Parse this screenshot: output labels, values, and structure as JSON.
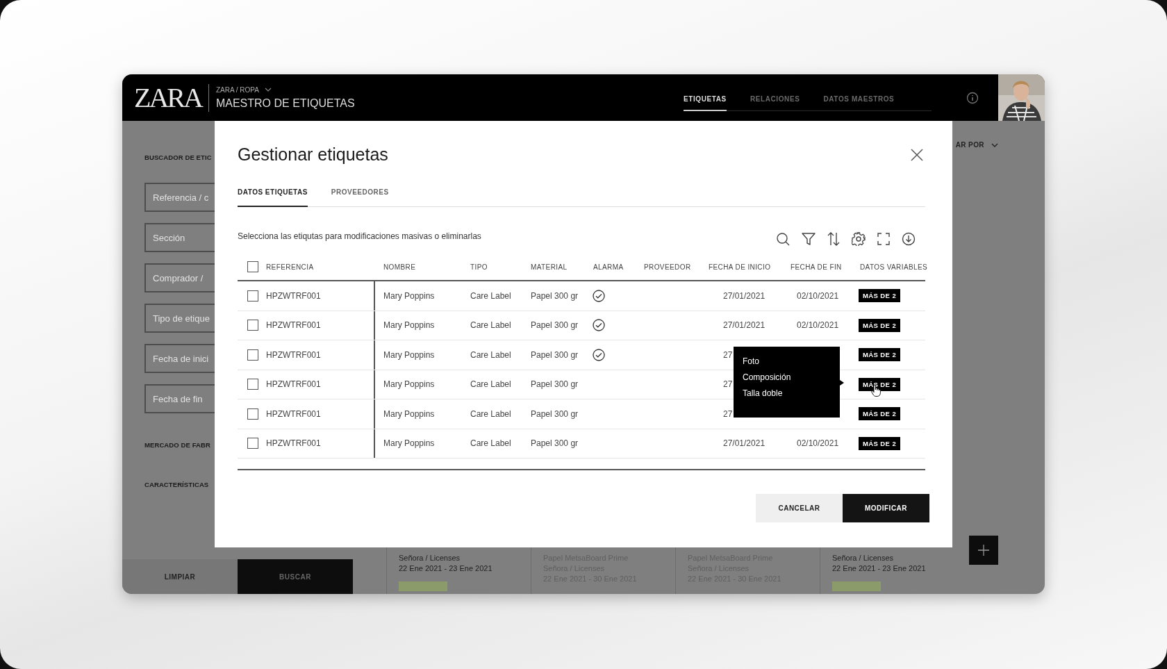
{
  "header": {
    "logo": "ZARA",
    "breadcrumb": "ZARA / ROPA",
    "title": "MAESTRO DE ETIQUETAS",
    "nav": [
      {
        "label": "ETIQUETAS",
        "selected": true
      },
      {
        "label": "RELACIONES",
        "selected": false
      },
      {
        "label": "DATOS MAESTROS",
        "selected": false
      }
    ]
  },
  "sidebar": {
    "heading": "BUSCADOR DE ETIC",
    "fields": [
      {
        "placeholder": "Referencia / c"
      },
      {
        "placeholder": "Sección"
      },
      {
        "placeholder": "Comprador / "
      },
      {
        "placeholder": "Tipo de etique"
      },
      {
        "placeholder": "Fecha de inici"
      },
      {
        "placeholder": "Fecha de fin"
      }
    ],
    "sections": [
      "MERCADO DE FABR",
      "CARACTERÍSTICAS"
    ],
    "buttons": [
      {
        "label": "LIMPIAR",
        "kind": "secondary"
      },
      {
        "label": "BUSCAR",
        "kind": "primary"
      }
    ]
  },
  "main": {
    "sort_label": "AR POR",
    "cards": [
      {
        "lines": [
          "Señora / Licenses",
          "22 Ene 2021 - 23 Ene 2021"
        ],
        "dimmed": false,
        "approved": true
      },
      {
        "lines": [
          "Papel MetsaBoard Prime",
          "Señora / Licenses",
          "22 Ene 2021 - 30 Ene 2021"
        ],
        "dimmed": true,
        "approved": false
      },
      {
        "lines": [
          "Papel MetsaBoard Prime",
          "Señora / Licenses",
          "22 Ene 2021 - 30 Ene 2021"
        ],
        "dimmed": true,
        "approved": false
      },
      {
        "lines": [
          "Señora / Licenses",
          "22 Ene 2021 - 23 Ene 2021"
        ],
        "dimmed": false,
        "approved": true
      }
    ]
  },
  "modal": {
    "title": "Gestionar etiquetas",
    "tabs": [
      {
        "label": "DATOS ETIQUETAS",
        "selected": true
      },
      {
        "label": "PROVEEDORES",
        "selected": false
      }
    ],
    "description": "Selecciona las etiqutas para modificaciones masivas o eliminarlas",
    "table": {
      "select_all": {
        "checked": false
      },
      "columns": [
        "REFERENCIA",
        "NOMBRE",
        "TIPO",
        "MATERIAL",
        "ALARMA",
        "PROVEEDOR",
        "FECHA DE INICIO",
        "FECHA DE FIN",
        "DATOS VARIABLES"
      ],
      "rows": [
        {
          "checked": false,
          "referencia": "HPZWTRF001",
          "nombre": "Mary Poppins",
          "tipo": "Care Label",
          "material": "Papel 300 gr",
          "alarm": true,
          "fecha_inicio": "27/01/2021",
          "fecha_fin": "02/10/2021",
          "datos_variables": "MÁS DE 2"
        },
        {
          "checked": false,
          "referencia": "HPZWTRF001",
          "nombre": "Mary Poppins",
          "tipo": "Care Label",
          "material": "Papel 300 gr",
          "alarm": true,
          "fecha_inicio": "27/01/2021",
          "fecha_fin": "02/10/2021",
          "datos_variables": "MÁS DE 2"
        },
        {
          "checked": false,
          "referencia": "HPZWTRF001",
          "nombre": "Mary Poppins",
          "tipo": "Care Label",
          "material": "Papel 300 gr",
          "alarm": true,
          "fecha_inicio": "27",
          "datos_variables": "MÁS DE 2"
        },
        {
          "checked": false,
          "referencia": "HPZWTRF001",
          "nombre": "Mary Poppins",
          "tipo": "Care Label",
          "material": "Papel 300 gr",
          "alarm": false,
          "fecha_inicio": "27",
          "datos_variables": "MÁS DE 2"
        },
        {
          "checked": false,
          "referencia": "HPZWTRF001",
          "nombre": "Mary Poppins",
          "tipo": "Care Label",
          "material": "Papel 300 gr",
          "alarm": false,
          "fecha_inicio": "27",
          "datos_variables": "MÁS DE 2"
        },
        {
          "checked": false,
          "referencia": "HPZWTRF001",
          "nombre": "Mary Poppins",
          "tipo": "Care Label",
          "material": "Papel 300 gr",
          "alarm": false,
          "fecha_inicio": "27/01/2021",
          "fecha_fin": "02/10/2021",
          "datos_variables": "MÁS DE 2"
        }
      ]
    },
    "popup": {
      "items": [
        "Foto",
        "Composición",
        "Talla doble"
      ]
    },
    "buttons": [
      {
        "label": "CANCELAR",
        "kind": "secondary"
      },
      {
        "label": "MODIFICAR",
        "kind": "primary"
      }
    ]
  }
}
